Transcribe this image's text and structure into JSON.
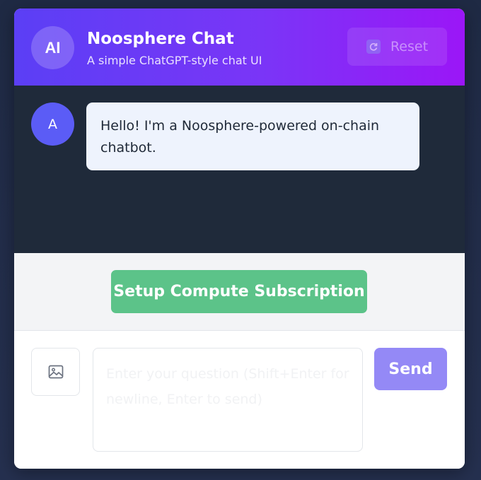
{
  "header": {
    "avatar_text": "AI",
    "title": "Noosphere Chat",
    "subtitle": "A simple ChatGPT-style chat UI",
    "reset_label": "Reset",
    "reset_icon": "refresh-icon"
  },
  "messages": [
    {
      "avatar_text": "A",
      "text": "Hello! I'm a Noosphere-powered on-chain chatbot."
    }
  ],
  "subscription": {
    "button_label": "Setup Compute Subscription"
  },
  "composer": {
    "image_icon": "image-icon",
    "placeholder": "Enter your question (Shift+Enter for newline, Enter to send)",
    "value": "",
    "send_label": "Send"
  },
  "colors": {
    "header_gradient_start": "#5b3ff5",
    "header_gradient_end": "#9b16f7",
    "messages_bg": "#1f2a3a",
    "bubble_bg": "#eef3fd",
    "bot_avatar": "#5b5cf6",
    "subscription_button": "#5cc389",
    "send_button": "#9489f6"
  }
}
